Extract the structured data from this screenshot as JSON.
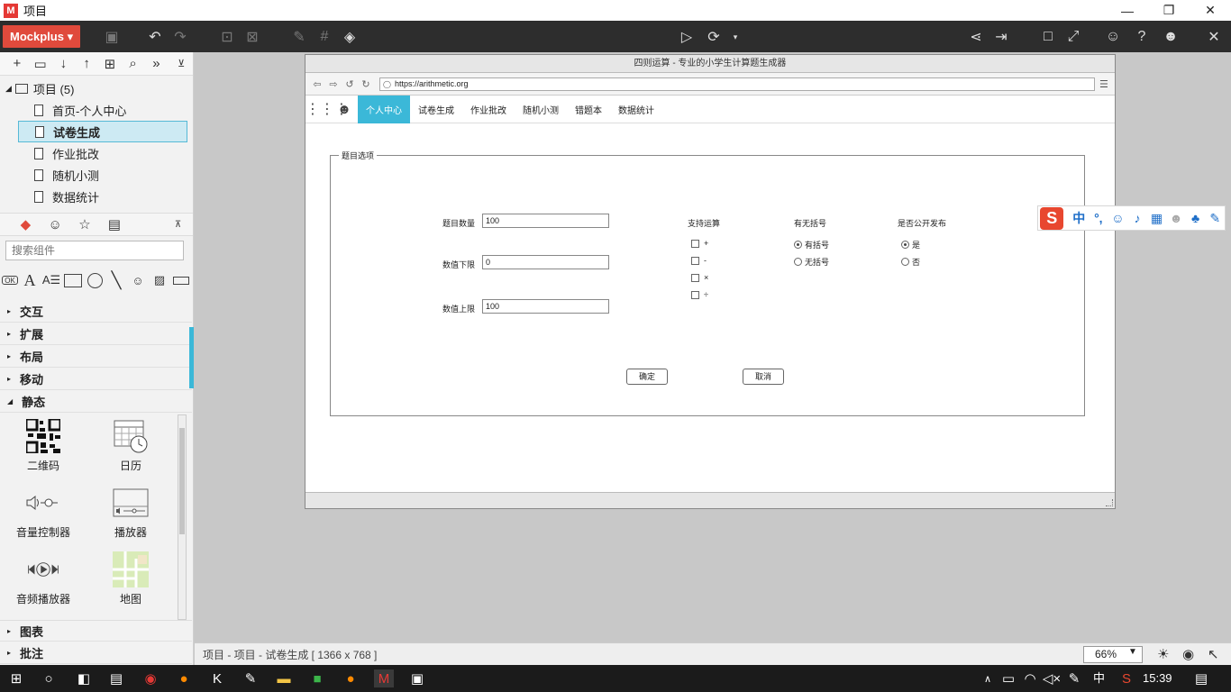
{
  "window": {
    "title": "项目"
  },
  "toolbar": {
    "brand": "Mockplus"
  },
  "left_panel": {
    "tree": {
      "root": "项目 (5)",
      "items": [
        "首页-个人中心",
        "试卷生成",
        "作业批改",
        "随机小测",
        "数据统计"
      ],
      "selected": "试卷生成"
    },
    "search_placeholder": "搜索组件",
    "categories": [
      "交互",
      "扩展",
      "布局",
      "移动",
      "静态",
      "图表",
      "批注"
    ],
    "static_components": [
      "二维码",
      "日历",
      "音量控制器",
      "播放器",
      "音频播放器",
      "地图"
    ]
  },
  "browser": {
    "title": "四则运算 - 专业的小学生计算题生成器",
    "url": "https://arithmetic.org",
    "nav": [
      "个人中心",
      "试卷生成",
      "作业批改",
      "随机小测",
      "错题本",
      "数据统计"
    ],
    "active_nav": "个人中心"
  },
  "form": {
    "legend": "题目选项",
    "fields": [
      {
        "label": "题目数量",
        "value": "100"
      },
      {
        "label": "数值下限",
        "value": "0"
      },
      {
        "label": "数值上限",
        "value": "100"
      }
    ],
    "ops_title": "支持运算",
    "ops": [
      "+",
      "-",
      "×",
      "÷"
    ],
    "brackets_title": "有无括号",
    "brackets": [
      {
        "label": "有括号",
        "checked": true
      },
      {
        "label": "无括号",
        "checked": false
      }
    ],
    "publish_title": "是否公开发布",
    "publish": [
      {
        "label": "是",
        "checked": true
      },
      {
        "label": "否",
        "checked": false
      }
    ],
    "confirm": "确定",
    "cancel": "取消"
  },
  "ime": {
    "mode": "中",
    "punct": "°,"
  },
  "statusbar": {
    "path": "项目 - 项目 - 试卷生成 [ 1366 x 768 ]",
    "zoom": "66%"
  },
  "taskbar": {
    "lang": "中",
    "time": "15:39"
  },
  "colors": {
    "accent": "#3bb8d8",
    "brand": "#e04a3c",
    "toolbar_bg": "#2d2d2d"
  }
}
